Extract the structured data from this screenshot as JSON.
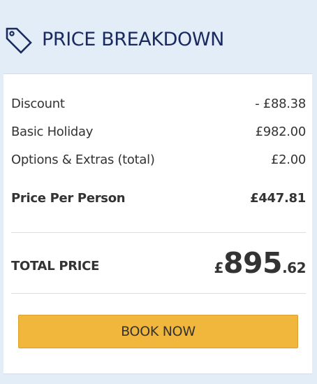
{
  "header": {
    "icon": "price-tag-icon",
    "title": "PRICE BREAKDOWN"
  },
  "breakdown": {
    "items": [
      {
        "label": "Discount",
        "value": "- £88.38"
      },
      {
        "label": "Basic Holiday",
        "value": "£982.00"
      },
      {
        "label": "Options & Extras (total)",
        "value": "£2.00"
      }
    ],
    "per_person": {
      "label": "Price Per Person",
      "value": "£447.81"
    }
  },
  "total": {
    "label": "TOTAL PRICE",
    "currency": "£",
    "main": "895",
    "decimal": ".62"
  },
  "actions": {
    "book_label": "BOOK NOW"
  },
  "colors": {
    "background": "#e3edf8",
    "title": "#1b2a5e",
    "button": "#f1b73d",
    "text": "#333333"
  }
}
